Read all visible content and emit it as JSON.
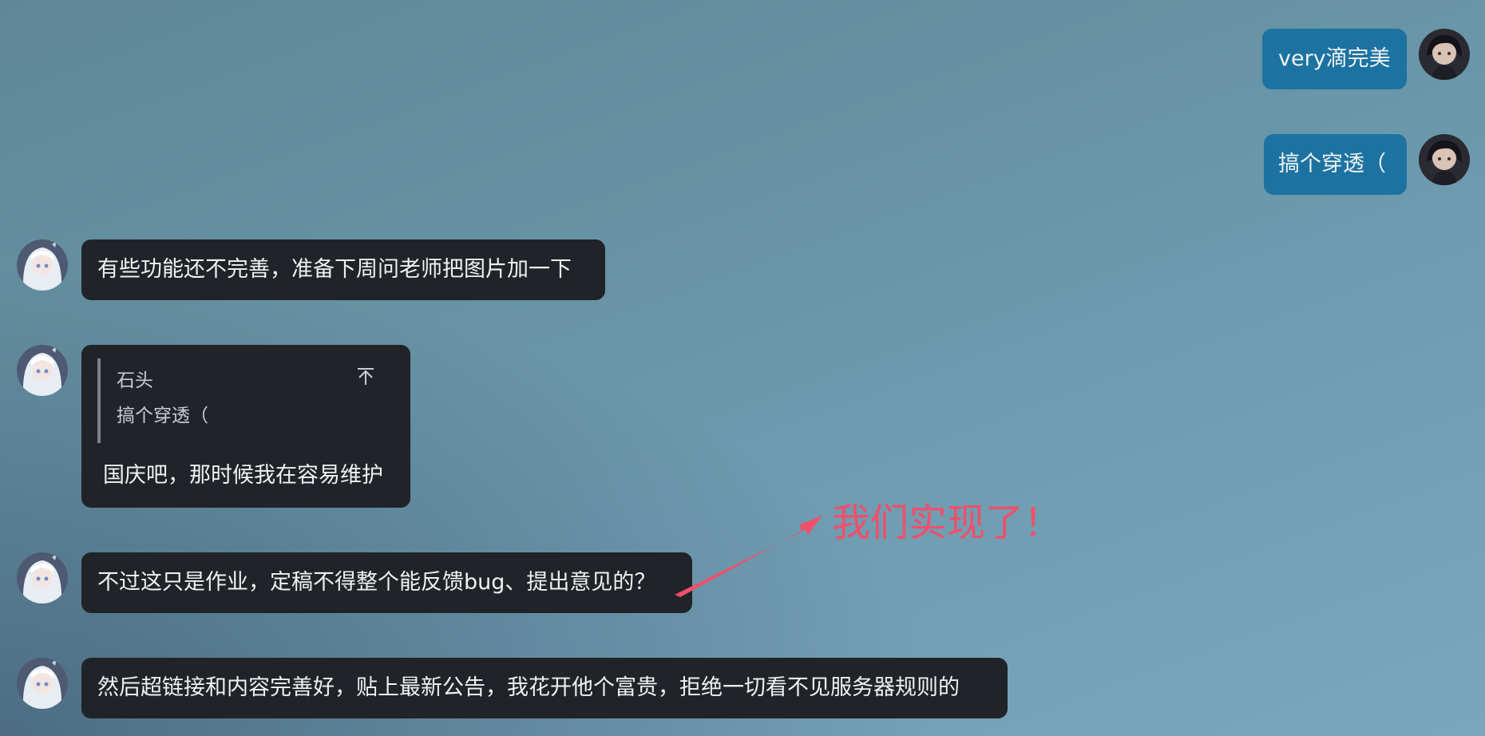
{
  "messages": [
    {
      "side": "right",
      "text": "very滴完美"
    },
    {
      "side": "right",
      "text": "搞个穿透（"
    },
    {
      "side": "left",
      "text": "有些功能还不完善，准备下周问老师把图片加一下"
    },
    {
      "side": "left",
      "reply": {
        "name": "石头",
        "text": "搞个穿透（"
      },
      "text": "国庆吧，那时候我在容易维护"
    },
    {
      "side": "left",
      "text": "不过这只是作业，定稿不得整个能反馈bug、提出意见的？"
    },
    {
      "side": "left",
      "text": "然后超链接和内容完善好，贴上最新公告，我花开他个富贵，拒绝一切看不见服务器规则的"
    }
  ],
  "annotation": {
    "text": "我们实现了！",
    "color": "#f0506a"
  },
  "colors": {
    "own_bubble": "#1c73a1",
    "other_bubble": "#202428"
  },
  "icons": {
    "jump_to_quoted": "arrow-up-to-line-icon"
  }
}
